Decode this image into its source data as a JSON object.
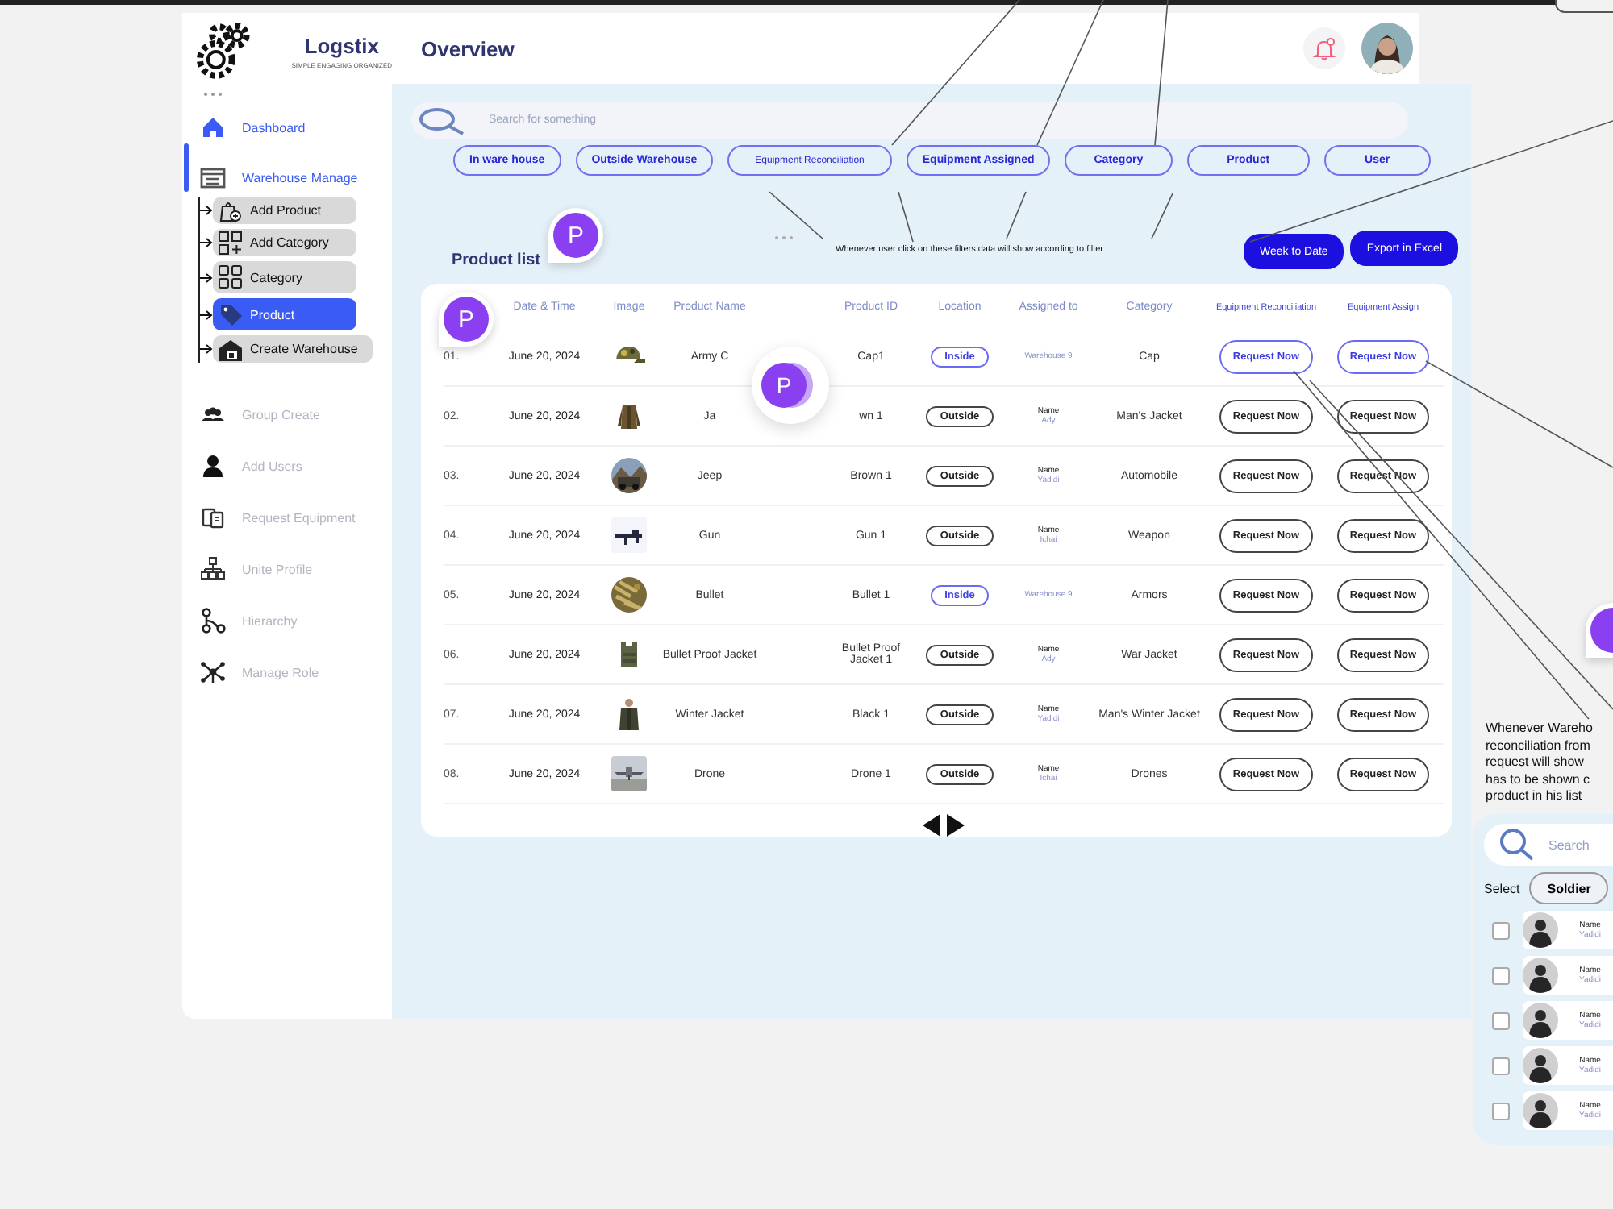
{
  "logo": {
    "title": "Logstix",
    "tagline": "SIMPLE ENGAGING ORGANIZED"
  },
  "sidebar": {
    "items": [
      {
        "label": "Dashboard",
        "selected": false,
        "disabled": false
      },
      {
        "label": "Warehouse Manage",
        "selected": true,
        "disabled": false,
        "children": [
          {
            "label": "Add Product",
            "selected": false
          },
          {
            "label": "Add Category",
            "selected": false
          },
          {
            "label": "Category",
            "selected": false
          },
          {
            "label": "Product",
            "selected": true
          },
          {
            "label": "Create Warehouse",
            "selected": false
          }
        ]
      },
      {
        "label": "Group Create",
        "selected": false,
        "disabled": true
      },
      {
        "label": "Add Users",
        "selected": false,
        "disabled": true
      },
      {
        "label": "Request Equipment",
        "selected": false,
        "disabled": true
      },
      {
        "label": "Unite Profile",
        "selected": false,
        "disabled": true
      },
      {
        "label": "Hierarchy",
        "selected": false,
        "disabled": true
      },
      {
        "label": "Manage Role",
        "selected": false,
        "disabled": true
      }
    ]
  },
  "header": {
    "title": "Overview",
    "notification": true
  },
  "search": {
    "placeholder": "Search for something"
  },
  "filters": [
    {
      "label": "In ware house",
      "kind": "regular"
    },
    {
      "label": "Outside Warehouse",
      "kind": "regular"
    },
    {
      "label": "Equipment Reconciliation",
      "kind": "small"
    },
    {
      "label": "Equipment Assigned",
      "kind": "regular"
    },
    {
      "label": "Category",
      "kind": "regular"
    },
    {
      "label": "Product",
      "kind": "regular"
    },
    {
      "label": "User",
      "kind": "regular"
    }
  ],
  "filter_note": "Whenever user click on these filters data will show according to filter",
  "product_list": {
    "title": "Product list",
    "buttons": [
      "Week to Date",
      "Export in Excel"
    ]
  },
  "table": {
    "columns": [
      "Date & Time",
      "Image",
      "Product Name",
      "Product ID",
      "Location",
      "Assigned to",
      "Category",
      "Equipment Reconciliation",
      "Equipment Assign"
    ],
    "rows": [
      {
        "number": "01.",
        "date": "June 20, 2024",
        "product_name": "Army C",
        "product_id": "Cap1",
        "location": {
          "text": "Inside",
          "highlighted": true
        },
        "assigned_to": {
          "kind": "warehouse",
          "text": "Warehouse 9"
        },
        "category": "Cap",
        "reconciliation": {
          "label": "Request Now",
          "highlighted": true
        },
        "assign": {
          "label": "Request Now",
          "highlighted": true
        }
      },
      {
        "number": "02.",
        "date": "June 20, 2024",
        "product_name": "Ja",
        "product_id": "wn 1",
        "location": {
          "text": "Outside",
          "highlighted": false
        },
        "assigned_to": {
          "kind": "person",
          "label": "Name",
          "text": "Ady"
        },
        "category": "Man's Jacket",
        "reconciliation": {
          "label": "Request Now",
          "highlighted": false
        },
        "assign": {
          "label": "Request Now",
          "highlighted": false
        }
      },
      {
        "number": "03.",
        "date": "June 20, 2024",
        "product_name": "Jeep",
        "product_id": "Brown 1",
        "location": {
          "text": "Outside",
          "highlighted": false
        },
        "assigned_to": {
          "kind": "person",
          "label": "Name",
          "text": "Yadidi"
        },
        "category": "Automobile",
        "reconciliation": {
          "label": "Request Now",
          "highlighted": false
        },
        "assign": {
          "label": "Request Now",
          "highlighted": false
        }
      },
      {
        "number": "04.",
        "date": "June 20, 2024",
        "product_name": "Gun",
        "product_id": "Gun 1",
        "location": {
          "text": "Outside",
          "highlighted": false
        },
        "assigned_to": {
          "kind": "person",
          "label": "Name",
          "text": "Ichai"
        },
        "category": "Weapon",
        "reconciliation": {
          "label": "Request Now",
          "highlighted": false
        },
        "assign": {
          "label": "Request Now",
          "highlighted": false
        }
      },
      {
        "number": "05.",
        "date": "June 20, 2024",
        "product_name": "Bullet",
        "product_id": "Bullet 1",
        "location": {
          "text": "Inside",
          "highlighted": true
        },
        "assigned_to": {
          "kind": "warehouse",
          "text": "Warehouse 9"
        },
        "category": "Armors",
        "reconciliation": {
          "label": "Request Now",
          "highlighted": false
        },
        "assign": {
          "label": "Request Now",
          "highlighted": false
        }
      },
      {
        "number": "06.",
        "date": "June 20, 2024",
        "product_name": "Bullet Proof Jacket",
        "product_id": "Bullet Proof Jacket 1",
        "location": {
          "text": "Outside",
          "highlighted": false
        },
        "assigned_to": {
          "kind": "person",
          "label": "Name",
          "text": "Ady"
        },
        "category": "War Jacket",
        "reconciliation": {
          "label": "Request Now",
          "highlighted": false
        },
        "assign": {
          "label": "Request Now",
          "highlighted": false
        }
      },
      {
        "number": "07.",
        "date": "June 20, 2024",
        "product_name": "Winter Jacket",
        "product_id": "Black 1",
        "location": {
          "text": "Outside",
          "highlighted": false
        },
        "assigned_to": {
          "kind": "person",
          "label": "Name",
          "text": "Yadidi"
        },
        "category": "Man's Winter Jacket",
        "reconciliation": {
          "label": "Request Now",
          "highlighted": false
        },
        "assign": {
          "label": "Request Now",
          "highlighted": false
        }
      },
      {
        "number": "08.",
        "date": "June 20, 2024",
        "product_name": "Drone",
        "product_id": "Drone 1",
        "location": {
          "text": "Outside",
          "highlighted": false
        },
        "assigned_to": {
          "kind": "person",
          "label": "Name",
          "text": "Ichai"
        },
        "category": "Drones",
        "reconciliation": {
          "label": "Request Now",
          "highlighted": false
        },
        "assign": {
          "label": "Request Now",
          "highlighted": false
        }
      }
    ]
  },
  "comment_pins": [
    {
      "kind": "pin",
      "initial": "P"
    },
    {
      "kind": "pin",
      "initial": "P"
    },
    {
      "kind": "magnified",
      "initial": "P"
    },
    {
      "kind": "edge"
    }
  ],
  "side_panel": {
    "note_lines": [
      "Whenever Wareho",
      "reconciliation from",
      "request will show",
      "has to be shown c",
      "product in his list"
    ],
    "search": {
      "placeholder": "Search"
    },
    "select_label": "Select",
    "filter_chip": "Soldier",
    "people": [
      {
        "checked": false,
        "label": "Name",
        "name": "Yadidi"
      },
      {
        "checked": false,
        "label": "Name",
        "name": "Yadidi"
      },
      {
        "checked": false,
        "label": "Name",
        "name": "Yadidi"
      },
      {
        "checked": false,
        "label": "Name",
        "name": "Yadidi"
      },
      {
        "checked": false,
        "label": "Name",
        "name": "Yadidi"
      }
    ]
  }
}
